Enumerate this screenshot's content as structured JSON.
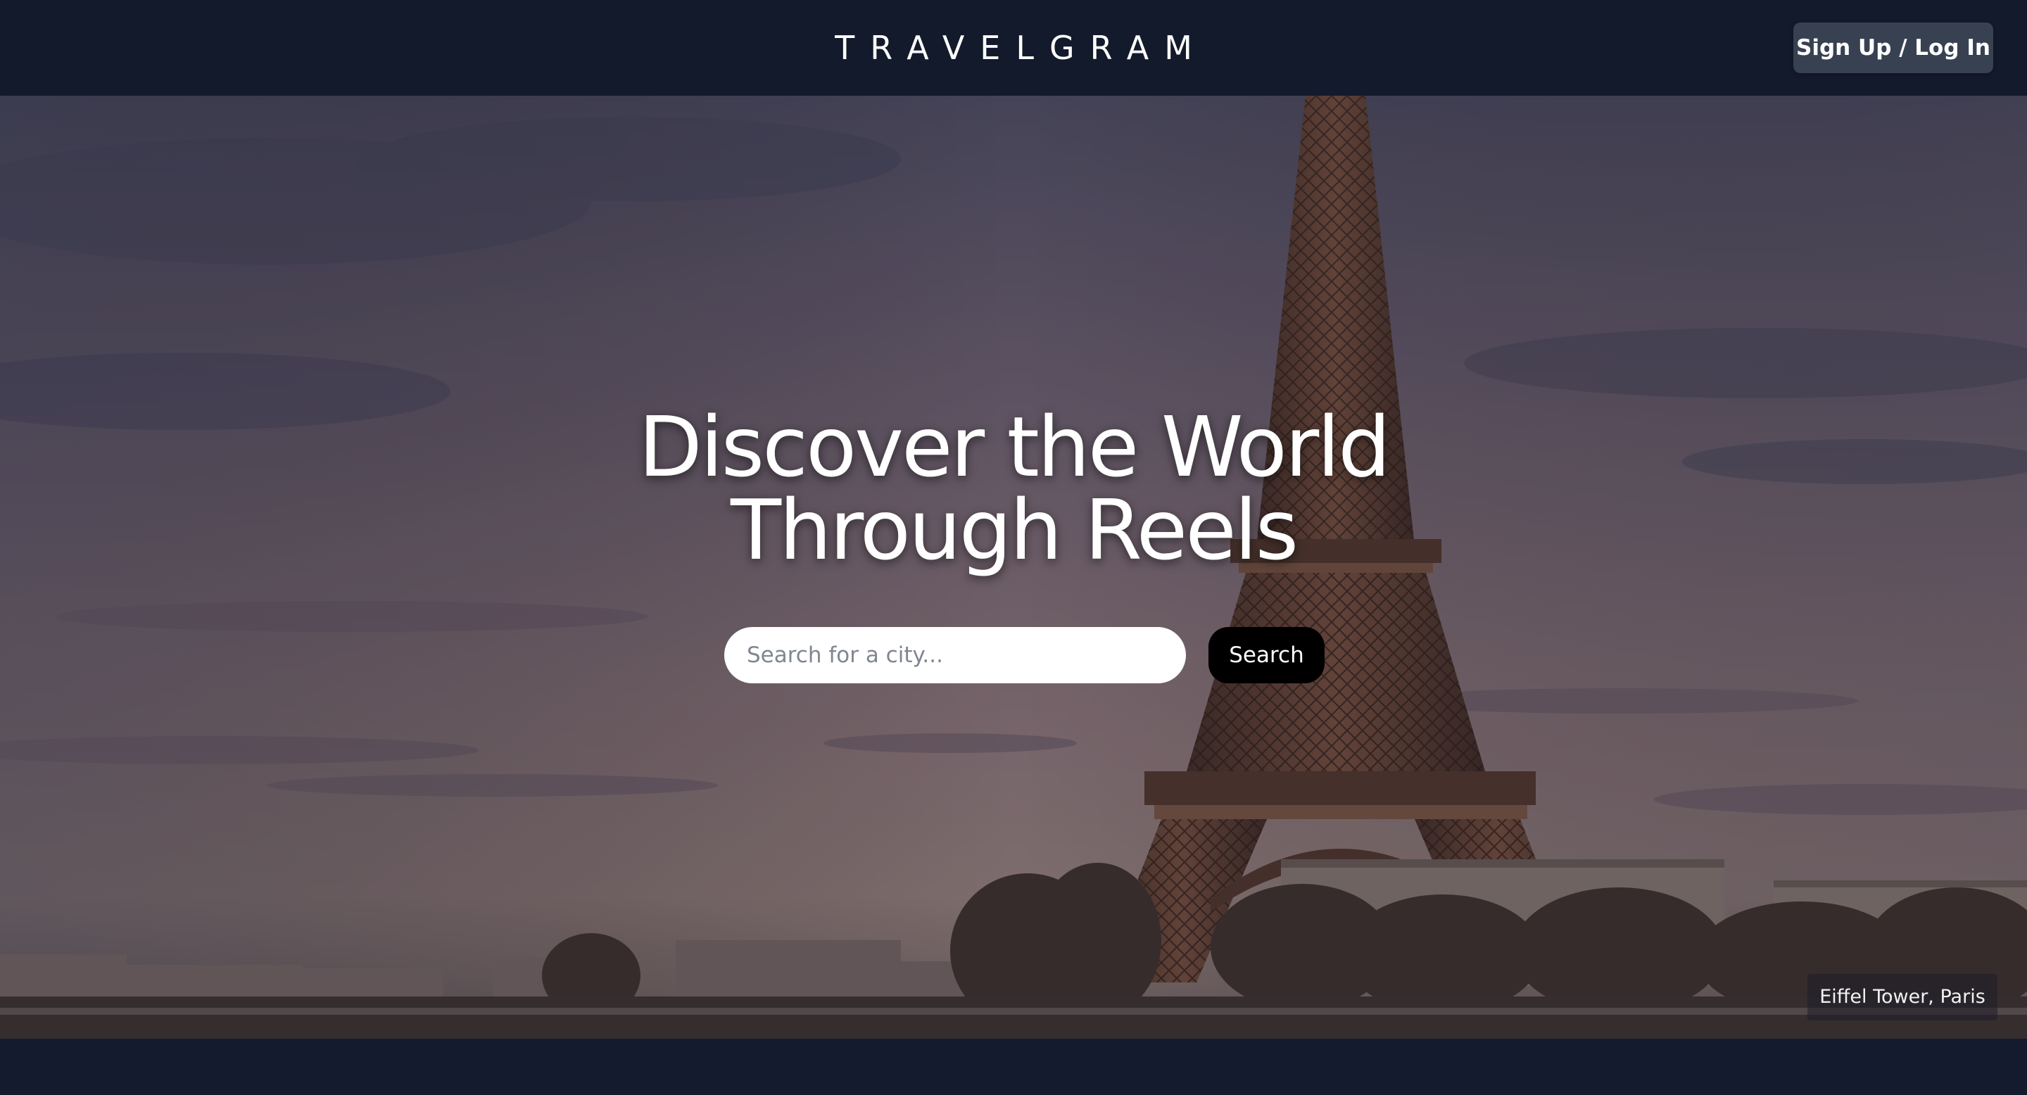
{
  "header": {
    "brand": "TRAVELGRAM",
    "auth_button_label": "Sign Up / Log In"
  },
  "hero": {
    "title_line1": "Discover the World",
    "title_line2": "Through Reels",
    "search": {
      "placeholder": "Search for a city...",
      "value": "",
      "button_label": "Search"
    },
    "caption": "Eiffel Tower, Paris",
    "background_image": "eiffel-tower-paris-photo"
  },
  "colors": {
    "header_bg": "#131a2b",
    "auth_button_bg": "#374151",
    "search_button_bg": "#000000",
    "page_bg": "#111827"
  }
}
